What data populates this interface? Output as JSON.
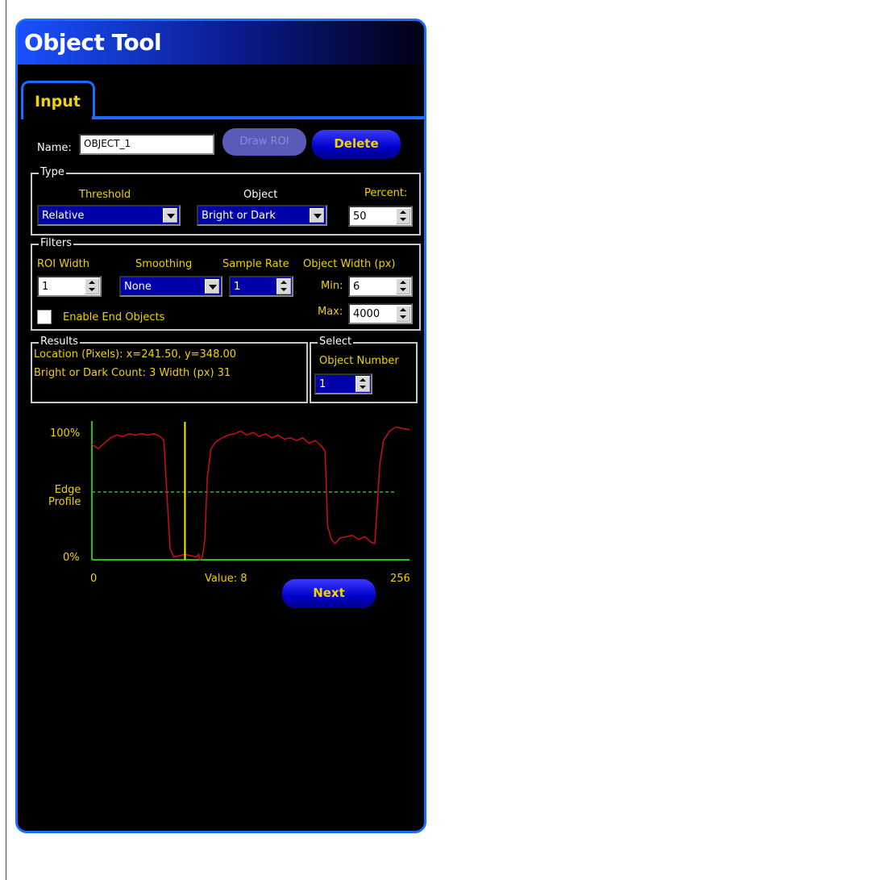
{
  "window": {
    "title": "Object Tool"
  },
  "tabs": [
    {
      "label": "Input"
    }
  ],
  "name_row": {
    "label": "Name:",
    "value": "OBJECT_1",
    "draw_roi": "Draw ROI",
    "delete": "Delete"
  },
  "type": {
    "title": "Type",
    "threshold_label": "Threshold",
    "threshold_value": "Relative",
    "object_label": "Object",
    "object_value": "Bright or Dark",
    "percent_label": "Percent:",
    "percent_value": "50"
  },
  "filters": {
    "title": "Filters",
    "roi_width_label": "ROI Width",
    "roi_width_value": "1",
    "smoothing_label": "Smoothing",
    "smoothing_value": "None",
    "sample_rate_label": "Sample Rate",
    "sample_rate_value": "1",
    "object_width_label": "Object Width  (px)",
    "min_label": "Min:",
    "min_value": "6",
    "max_label": "Max:",
    "max_value": "4000",
    "enable_end_label": "Enable End Objects",
    "enable_end_checked": false
  },
  "results": {
    "title": "Results",
    "location": "Location (Pixels):    x=241.50, y=348.00",
    "count": "Bright or Dark Count:  3      Width (px)  31"
  },
  "select": {
    "title": "Select",
    "label": "Object Number",
    "value": "1"
  },
  "chart": {
    "y_top": "100%",
    "y_mid": "Edge\nProfile",
    "y_mid_line1": "Edge",
    "y_mid_line2": "Profile",
    "y_bottom": "0%",
    "x_left": "0",
    "x_right": "256",
    "value_label": "Value:  8",
    "next": "Next"
  },
  "chart_data": {
    "type": "line",
    "title": "",
    "xlabel": "Value:  8",
    "ylabel": "Edge Profile",
    "xlim": [
      0,
      256
    ],
    "ylim": [
      0,
      100
    ],
    "threshold_line": 50,
    "cursor_x": 75,
    "series": [
      {
        "points": [
          [
            0,
            85
          ],
          [
            5,
            82
          ],
          [
            10,
            86
          ],
          [
            15,
            90
          ],
          [
            20,
            92
          ],
          [
            25,
            91
          ],
          [
            30,
            93
          ],
          [
            35,
            92
          ],
          [
            40,
            93
          ],
          [
            45,
            92
          ],
          [
            50,
            93
          ],
          [
            55,
            91
          ],
          [
            58,
            88
          ],
          [
            61,
            40
          ],
          [
            63,
            8
          ],
          [
            66,
            2
          ],
          [
            70,
            3
          ],
          [
            75,
            4
          ],
          [
            80,
            3
          ],
          [
            84,
            2
          ],
          [
            86,
            4
          ],
          [
            87,
            0
          ],
          [
            89,
            2
          ],
          [
            91,
            15
          ],
          [
            93,
            60
          ],
          [
            96,
            82
          ],
          [
            100,
            87
          ],
          [
            105,
            90
          ],
          [
            110,
            92
          ],
          [
            115,
            93
          ],
          [
            120,
            95
          ],
          [
            125,
            92
          ],
          [
            130,
            94
          ],
          [
            135,
            91
          ],
          [
            140,
            93
          ],
          [
            145,
            90
          ],
          [
            150,
            92
          ],
          [
            155,
            89
          ],
          [
            160,
            90
          ],
          [
            165,
            88
          ],
          [
            170,
            90
          ],
          [
            175,
            86
          ],
          [
            180,
            88
          ],
          [
            185,
            84
          ],
          [
            188,
            80
          ],
          [
            190,
            25
          ],
          [
            193,
            15
          ],
          [
            196,
            12
          ],
          [
            200,
            16
          ],
          [
            205,
            17
          ],
          [
            210,
            18
          ],
          [
            215,
            15
          ],
          [
            220,
            17
          ],
          [
            225,
            13
          ],
          [
            228,
            12
          ],
          [
            230,
            40
          ],
          [
            232,
            70
          ],
          [
            235,
            88
          ],
          [
            240,
            95
          ],
          [
            245,
            98
          ],
          [
            250,
            97
          ],
          [
            256,
            96
          ]
        ]
      }
    ],
    "colors": {
      "line": "#cc1010",
      "threshold": "#20c020",
      "cursor": "#f0f000",
      "axis": "#20c020"
    }
  }
}
